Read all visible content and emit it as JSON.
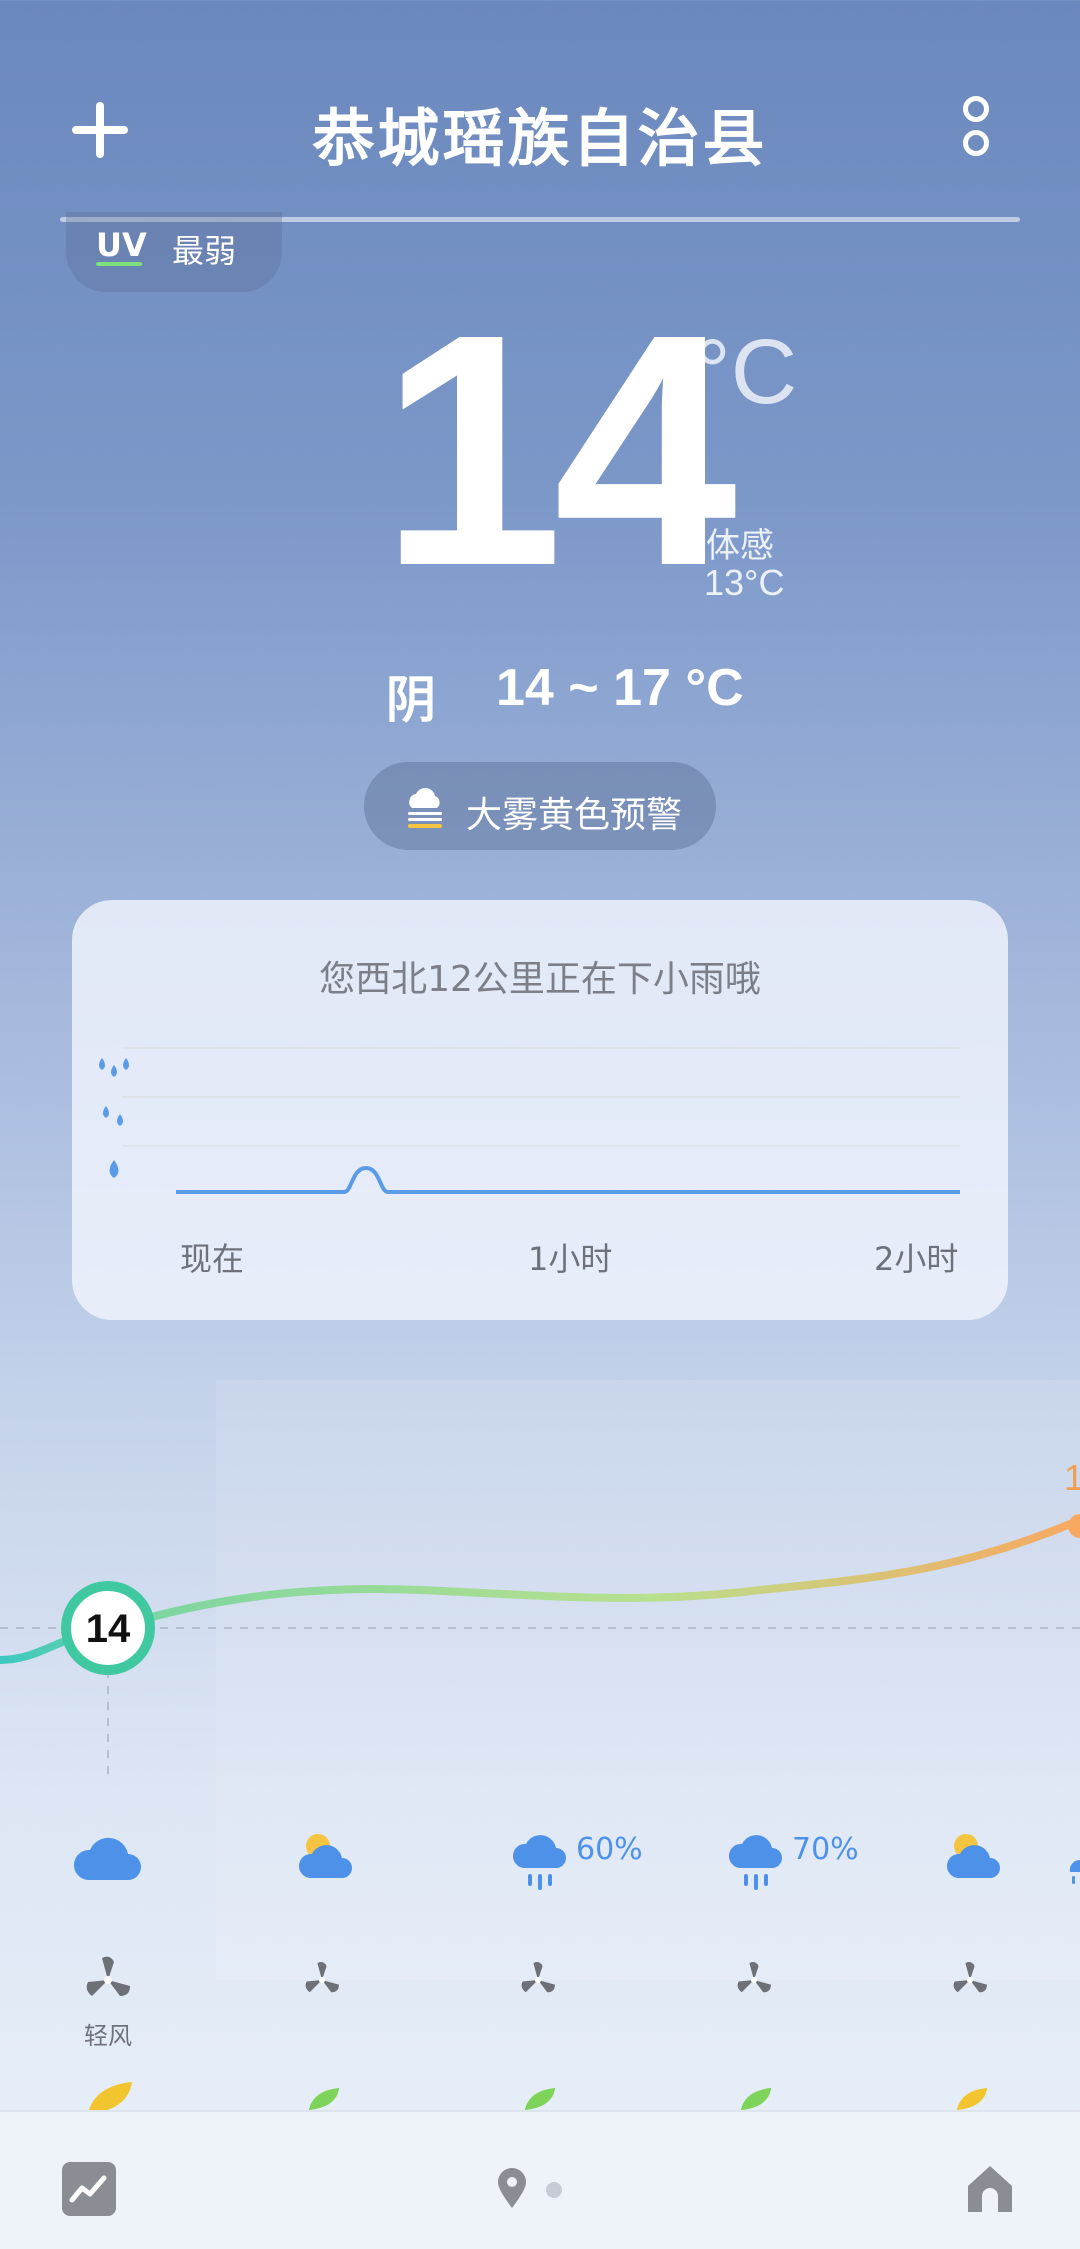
{
  "header": {
    "add_label": "+",
    "city": "恭城瑶族自治县"
  },
  "uv": {
    "label": "UV",
    "value": "最弱"
  },
  "current": {
    "temp": "14",
    "unit": "°C",
    "feels_label": "体感",
    "feels_value": "13°C",
    "condition": "阴",
    "range": "14 ~ 17 °C"
  },
  "alert": {
    "text": "大雾黄色预警"
  },
  "rain_card": {
    "title": "您西北12公里正在下小雨哦",
    "ticks": [
      "现在",
      "1小时",
      "2小时"
    ]
  },
  "hourly": {
    "current_temp": "14",
    "right_edge_temp": "1",
    "items": [
      {
        "icon": "cloud-icon",
        "precip": "",
        "wind_label": "轻风"
      },
      {
        "icon": "partly-cloudy-icon",
        "precip": "",
        "wind_label": ""
      },
      {
        "icon": "rain-cloud-icon",
        "precip": "60%",
        "wind_label": ""
      },
      {
        "icon": "rain-cloud-icon",
        "precip": "70%",
        "wind_label": ""
      },
      {
        "icon": "partly-cloudy-icon",
        "precip": "",
        "wind_label": ""
      }
    ],
    "colors": {
      "line_start": "#3cc8c0",
      "line_mid": "#a8dc8c",
      "line_end": "#f8a860",
      "rain": "#4d92e8"
    }
  },
  "bottom_nav": {
    "trend": "trend-icon",
    "location": "location-icon",
    "home": "home-icon"
  }
}
